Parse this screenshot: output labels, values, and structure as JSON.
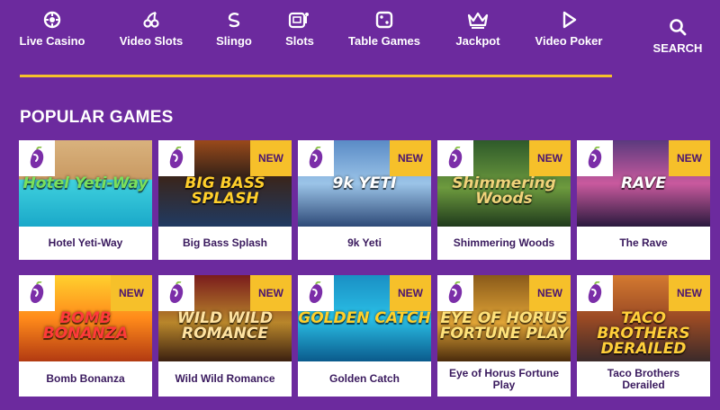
{
  "nav": {
    "items": [
      {
        "label": "Live Casino",
        "icon": "chip-icon"
      },
      {
        "label": "Video Slots",
        "icon": "cherries-icon"
      },
      {
        "label": "Slingo",
        "icon": "slingo-icon"
      },
      {
        "label": "Slots",
        "icon": "slot-machine-icon"
      },
      {
        "label": "Table Games",
        "icon": "dice-icon"
      },
      {
        "label": "Jackpot",
        "icon": "crown-icon"
      },
      {
        "label": "Video Poker",
        "icon": "play-icon"
      }
    ],
    "search_label": "SEARCH",
    "active_progress": 1.0
  },
  "section": {
    "title": "POPULAR GAMES"
  },
  "badge_new_label": "NEW",
  "colors": {
    "background": "#6c2a9e",
    "accent": "#f6c02a",
    "card_text": "#3a1a5e"
  },
  "games": [
    {
      "name": "Hotel Yeti-Way",
      "art_title": "Hotel Yeti-Way",
      "is_new": false
    },
    {
      "name": "Big Bass Splash",
      "art_title": "BIG BASS SPLASH",
      "is_new": true
    },
    {
      "name": "9k Yeti",
      "art_title": "9k YETI",
      "is_new": true
    },
    {
      "name": "Shimmering Woods",
      "art_title": "Shimmering Woods",
      "is_new": true
    },
    {
      "name": "The Rave",
      "art_title": "RAVE",
      "is_new": true
    },
    {
      "name": "Bomb Bonanza",
      "art_title": "BOMB BONANZA",
      "is_new": true
    },
    {
      "name": "Wild Wild Romance",
      "art_title": "WILD WILD ROMANCE",
      "is_new": true
    },
    {
      "name": "Golden Catch",
      "art_title": "GOLDEN CATCH",
      "is_new": true
    },
    {
      "name": "Eye of Horus Fortune Play",
      "art_title": "EYE OF HORUS FORTUNE PLAY",
      "is_new": true
    },
    {
      "name": "Taco Brothers Derailed",
      "art_title": "TACO BROTHERS DERAILED",
      "is_new": true
    }
  ]
}
